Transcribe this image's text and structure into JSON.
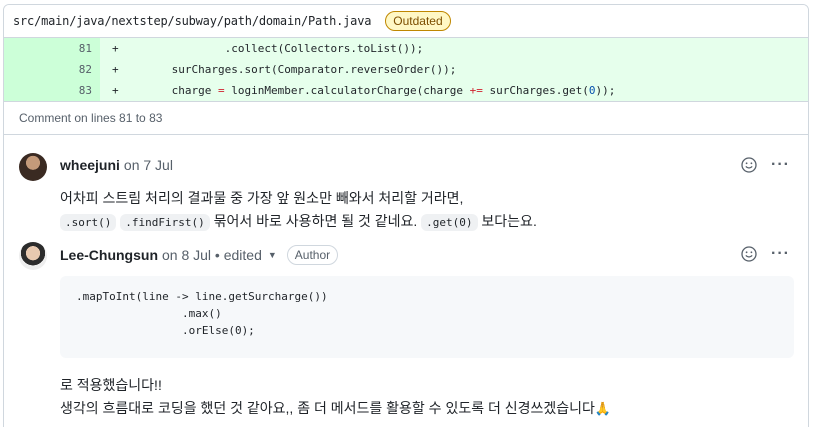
{
  "file": {
    "path": "src/main/java/nextstep/subway/path/domain/Path.java",
    "badge": "Outdated"
  },
  "diff": {
    "lines": [
      {
        "num": "81",
        "sign": "+",
        "code_pre": "                .collect(Collectors.toList());",
        "op": "",
        "code_mid": "",
        "op2": "",
        "code_mid2": "",
        "num_tok": "",
        "code_post": ""
      },
      {
        "num": "82",
        "sign": "+",
        "code_pre": "        surCharges.sort(Comparator.reverseOrder());",
        "op": "",
        "code_mid": "",
        "op2": "",
        "code_mid2": "",
        "num_tok": "",
        "code_post": ""
      },
      {
        "num": "83",
        "sign": "+",
        "code_pre": "        charge ",
        "op": "=",
        "code_mid": " loginMember.calculatorCharge(charge ",
        "op2": "+=",
        "code_mid2": " surCharges.get(",
        "num_tok": "0",
        "code_post": "));"
      }
    ]
  },
  "comment_on": "Comment on lines 81 to 83",
  "comments": [
    {
      "author": "wheejuni",
      "meta": "on 7 Jul",
      "body_line1": "어차피 스트림 처리의 결과물 중 가장 앞 원소만 빼와서 처리할 거라면,",
      "code1": ".sort()",
      "code2": ".findFirst()",
      "text_mid": " 묶어서 바로 사용하면 될 것 같네요. ",
      "code3": ".get(0)",
      "text_end": " 보다는요."
    },
    {
      "author": "Lee-Chungsun",
      "meta": "on 8 Jul • edited",
      "badge": "Author",
      "code_block": ".mapToInt(line -> line.getSurcharge())\n                .max()\n                .orElse(0);",
      "body_line1": "로 적용했습니다!!",
      "body_line2": "생각의 흐름대로 코딩을 했던 것 같아요,, 좀 더 메서드를 활용할 수 있도록 더 신경쓰겠습니다",
      "emoji": "🙏"
    }
  ],
  "icons": {
    "reaction": "smiley-icon",
    "more": "kebab-horizontal-icon",
    "dropdown": "triangle-down-icon"
  }
}
